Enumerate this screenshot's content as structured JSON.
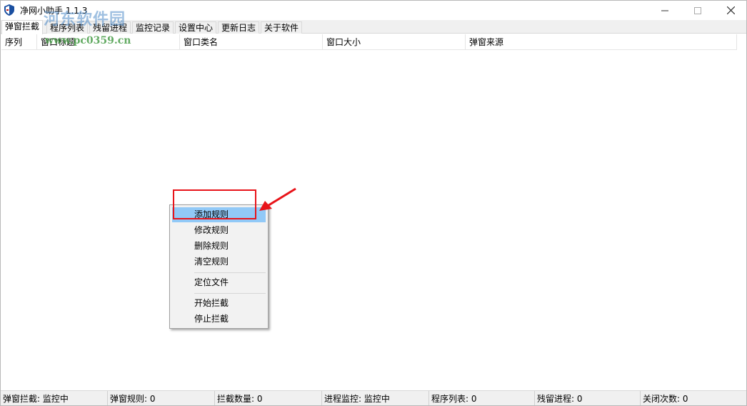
{
  "window": {
    "title": "净网小助手 1.1.3",
    "watermark": "河东软件园",
    "watermark_url": "www.pc0359.cn"
  },
  "tabs": [
    {
      "label": "弹窗拦截",
      "active": true
    },
    {
      "label": "程序列表"
    },
    {
      "label": "残留进程"
    },
    {
      "label": "监控记录"
    },
    {
      "label": "设置中心"
    },
    {
      "label": "更新日志"
    },
    {
      "label": "关于软件"
    }
  ],
  "table": {
    "columns": [
      "序列",
      "窗口标题",
      "窗口类名",
      "窗口大小",
      "弹窗来源"
    ]
  },
  "context_menu": {
    "items": [
      "添加规则",
      "修改规则",
      "删除规则",
      "清空规则",
      "定位文件",
      "开始拦截",
      "停止拦截"
    ]
  },
  "statusbar": [
    "弹窗拦截: 监控中",
    "弹窗规则: 0",
    "拦截数量: 0",
    "进程监控: 监控中",
    "程序列表: 0",
    "残留进程: 0",
    "关闭次数: 0"
  ],
  "colors": {
    "highlight": "#91c9f7",
    "annotation": "#e8141a"
  }
}
